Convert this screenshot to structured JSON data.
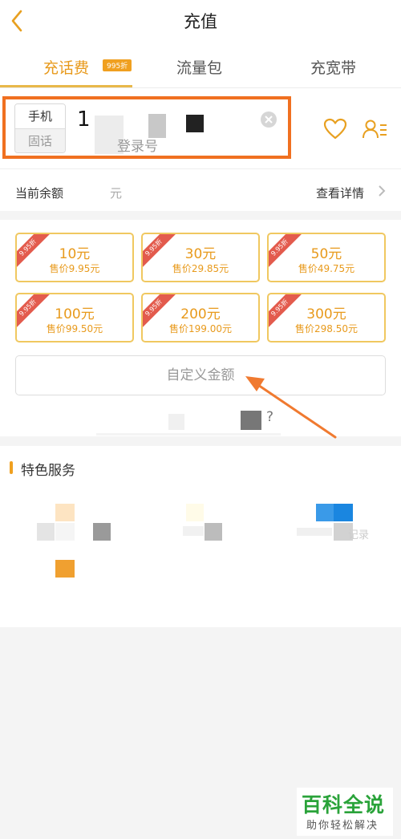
{
  "header": {
    "title": "充值"
  },
  "tabs": [
    {
      "label": "充话费",
      "active": true,
      "badge": "995折"
    },
    {
      "label": "流量包",
      "active": false
    },
    {
      "label": "充宽带",
      "active": false
    }
  ],
  "phone": {
    "type_options": [
      "手机",
      "固话"
    ],
    "selected_type": "手机",
    "value": "1",
    "placeholder": "登录号"
  },
  "balance": {
    "label": "当前余额",
    "unit": "元",
    "link": "查看详情"
  },
  "amounts": [
    {
      "amount": "10元",
      "price": "售价9.95元",
      "ribbon": "9.95折"
    },
    {
      "amount": "30元",
      "price": "售价29.85元",
      "ribbon": "9.95折"
    },
    {
      "amount": "50元",
      "price": "售价49.75元",
      "ribbon": "9.95折"
    },
    {
      "amount": "100元",
      "price": "售价99.50元",
      "ribbon": "9.95折"
    },
    {
      "amount": "200元",
      "price": "售价199.00元",
      "ribbon": "9.95折"
    },
    {
      "amount": "300元",
      "price": "售价298.50元",
      "ribbon": "9.95折"
    }
  ],
  "custom_amount": "自定义金额",
  "faq_fragment": "?",
  "featured": {
    "title": "特色服务",
    "item3_fragment": "记录"
  },
  "watermark": {
    "main": "百科全说",
    "sub": "助你轻松解决"
  },
  "colors": {
    "accent": "#e89a1c",
    "highlight_box": "#f07020",
    "ribbon": "#e35b4d",
    "brand_green": "#2aa33a"
  }
}
